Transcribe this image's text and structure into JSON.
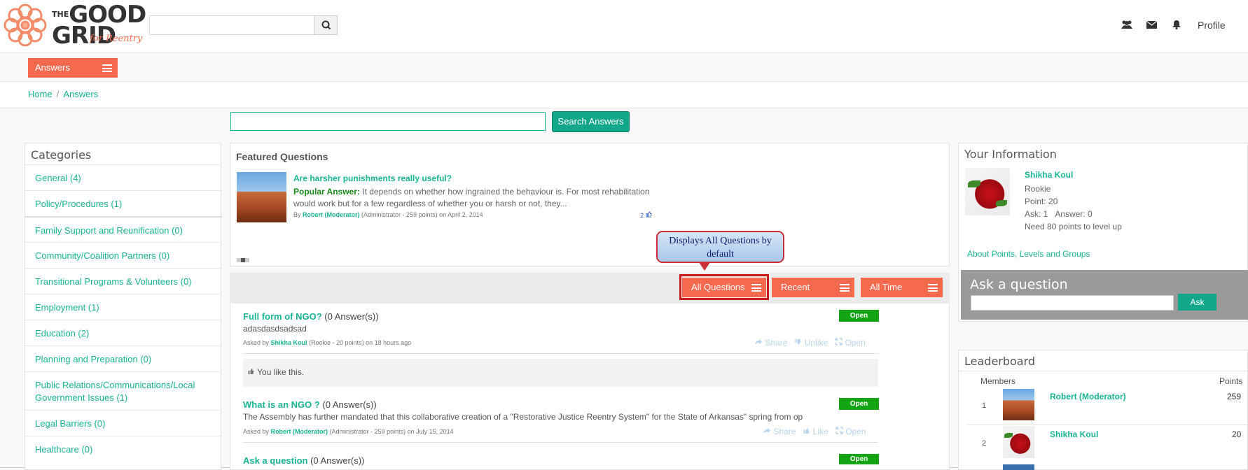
{
  "header": {
    "logo_main_1": "THE",
    "logo_main_2": "GOOD",
    "logo_main_3": "GRID",
    "logo_sub": "for Reentry",
    "search_value": "",
    "profile_label": "Profile"
  },
  "nav": {
    "answers_tab": "Answers",
    "breadcrumb": [
      "Home",
      "Answers"
    ],
    "search_button": "Search Answers"
  },
  "categories": {
    "title": "Categories",
    "items": [
      "General (4)",
      "Policy/Procedures (1)",
      "Family Support and Reunification (0)",
      "Community/Coalition Partners (0)",
      "Transitional Programs & Volunteers (0)",
      "Employment (1)",
      "Education (2)",
      "Planning and Preparation (0)",
      "Public Relations/Communications/Local",
      "Government Issues (1)",
      "Legal Barriers (0)",
      "Healthcare (0)"
    ]
  },
  "featured": {
    "title": "Featured Questions",
    "question": "Are harsher punishments really useful?",
    "popular_label": "Popular Answer:",
    "answer_line1": "It depends on whether how ingrained the behaviour is. For most rehabilitation",
    "answer_line2": "would work but for a few regardless of whether you or harsh or not, they...",
    "by": "By",
    "author": "Robert (Moderator)",
    "author_meta": "(Administrator - 259 points)  on April 2, 2014",
    "likes": "2"
  },
  "callout": "Displays All Questions by default",
  "filters": {
    "all_questions": "All Questions",
    "recent": "Recent",
    "all_time": "All Time"
  },
  "questions": [
    {
      "title": "Full form of NGO?",
      "count": "(0 Answer(s))",
      "body": "adasdasdsadsad",
      "asked_by": "Asked by",
      "author": "Shikha Koul",
      "meta": "(Rookie - 20 points)  on 18 hours ago",
      "status": "Open",
      "actions": [
        "Share",
        "Unlike",
        "Open"
      ],
      "like_note": "You like this."
    },
    {
      "title": "What is an NGO ?",
      "count": "(0 Answer(s))",
      "body": "The Assembly has further mandated that this collaborative creation of a \"Restorative Justice Reentry System\" for the State of Arkansas\" spring from op...",
      "asked_by": "Asked by",
      "author": "Robert (Moderator)",
      "meta": "(Administrator - 259 points)  on July 15, 2014",
      "status": "Open",
      "actions": [
        "Share",
        "Like",
        "Open"
      ]
    },
    {
      "title": "Ask a question",
      "count": "(0 Answer(s))",
      "status": "Open"
    }
  ],
  "your_info": {
    "title": "Your Information",
    "name": "Shikha Koul",
    "rank": "Rookie",
    "point": "Point: 20",
    "ask": "Ask: 1",
    "answer": "Answer: 0",
    "need": "Need 80 points to level up",
    "link": "About Points, Levels and Groups"
  },
  "ask_box": {
    "title": "Ask a question",
    "button": "Ask"
  },
  "leaderboard": {
    "title": "Leaderboard",
    "col_members": "Members",
    "col_points": "Points",
    "rows": [
      {
        "rank": "1",
        "name": "Robert (Moderator)",
        "points": "259"
      },
      {
        "rank": "2",
        "name": "Shikha Koul",
        "points": "20"
      }
    ]
  },
  "colors": {
    "accent": "#f5694f",
    "teal": "#1ab394",
    "open_badge": "#14a514",
    "callout_border": "#c9303a"
  },
  "icons": [
    "search-icon",
    "users-icon",
    "envelope-icon",
    "bell-icon",
    "menu-icon",
    "thumbs-up-icon",
    "share-icon",
    "expand-icon"
  ]
}
